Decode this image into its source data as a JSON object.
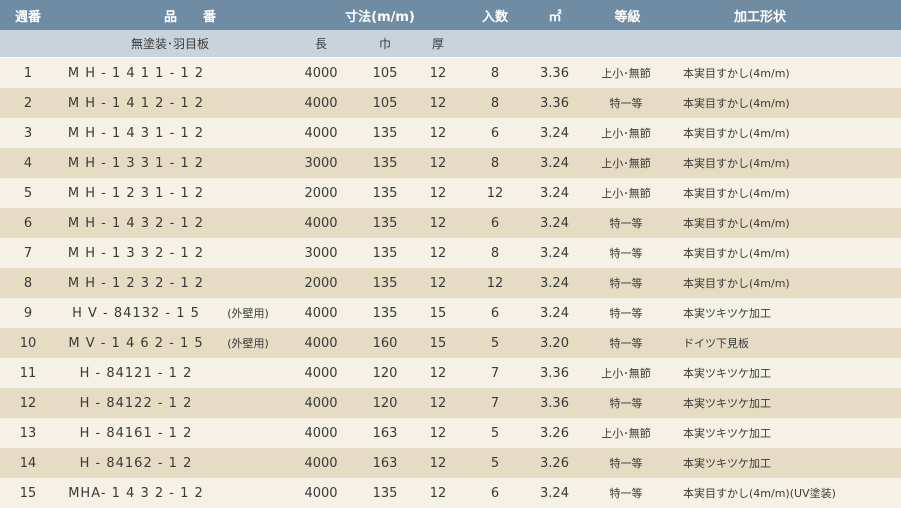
{
  "header": {
    "week": "週番",
    "product": "品　　番",
    "dimensions": "寸法(m/m)",
    "quantity": "入数",
    "area": "㎡",
    "grade": "等級",
    "processing": "加工形状"
  },
  "subheader": {
    "category": "無塗装･羽目板",
    "length": "長",
    "width": "巾",
    "thickness": "厚"
  },
  "rows": [
    {
      "no": "1",
      "part": "M H - 1 4 1 1 - 1 2",
      "note": "",
      "length": "4000",
      "width": "105",
      "thickness": "12",
      "qty": "8",
      "area": "3.36",
      "grade": "上小･無節",
      "shape": "本実目すかし(4m/m)"
    },
    {
      "no": "2",
      "part": "M H - 1 4 1 2 - 1 2",
      "note": "",
      "length": "4000",
      "width": "105",
      "thickness": "12",
      "qty": "8",
      "area": "3.36",
      "grade": "特一等",
      "shape": "本実目すかし(4m/m)"
    },
    {
      "no": "3",
      "part": "M H - 1 4 3 1 - 1 2",
      "note": "",
      "length": "4000",
      "width": "135",
      "thickness": "12",
      "qty": "6",
      "area": "3.24",
      "grade": "上小･無節",
      "shape": "本実目すかし(4m/m)"
    },
    {
      "no": "4",
      "part": "M H - 1 3 3 1 - 1 2",
      "note": "",
      "length": "3000",
      "width": "135",
      "thickness": "12",
      "qty": "8",
      "area": "3.24",
      "grade": "上小･無節",
      "shape": "本実目すかし(4m/m)"
    },
    {
      "no": "5",
      "part": "M H - 1 2 3 1 - 1 2",
      "note": "",
      "length": "2000",
      "width": "135",
      "thickness": "12",
      "qty": "12",
      "area": "3.24",
      "grade": "上小･無節",
      "shape": "本実目すかし(4m/m)"
    },
    {
      "no": "6",
      "part": "M H - 1 4 3 2 - 1 2",
      "note": "",
      "length": "4000",
      "width": "135",
      "thickness": "12",
      "qty": "6",
      "area": "3.24",
      "grade": "特一等",
      "shape": "本実目すかし(4m/m)"
    },
    {
      "no": "7",
      "part": "M H - 1 3 3 2 - 1 2",
      "note": "",
      "length": "3000",
      "width": "135",
      "thickness": "12",
      "qty": "8",
      "area": "3.24",
      "grade": "特一等",
      "shape": "本実目すかし(4m/m)"
    },
    {
      "no": "8",
      "part": "M H - 1 2 3 2 - 1 2",
      "note": "",
      "length": "2000",
      "width": "135",
      "thickness": "12",
      "qty": "12",
      "area": "3.24",
      "grade": "特一等",
      "shape": "本実目すかし(4m/m)"
    },
    {
      "no": "9",
      "part": "H V - 84132 - 1 5",
      "note": "(外壁用)",
      "length": "4000",
      "width": "135",
      "thickness": "15",
      "qty": "6",
      "area": "3.24",
      "grade": "特一等",
      "shape": "本実ツキツケ加工"
    },
    {
      "no": "10",
      "part": "M V - 1 4 6 2 - 1 5",
      "note": "(外壁用)",
      "length": "4000",
      "width": "160",
      "thickness": "15",
      "qty": "5",
      "area": "3.20",
      "grade": "特一等",
      "shape": "ドイツ下見板"
    },
    {
      "no": "11",
      "part": "H - 84121 - 1 2",
      "note": "",
      "length": "4000",
      "width": "120",
      "thickness": "12",
      "qty": "7",
      "area": "3.36",
      "grade": "上小･無節",
      "shape": "本実ツキツケ加工"
    },
    {
      "no": "12",
      "part": "H - 84122 - 1 2",
      "note": "",
      "length": "4000",
      "width": "120",
      "thickness": "12",
      "qty": "7",
      "area": "3.36",
      "grade": "特一等",
      "shape": "本実ツキツケ加工"
    },
    {
      "no": "13",
      "part": "H - 84161 - 1 2",
      "note": "",
      "length": "4000",
      "width": "163",
      "thickness": "12",
      "qty": "5",
      "area": "3.26",
      "grade": "上小･無節",
      "shape": "本実ツキツケ加工"
    },
    {
      "no": "14",
      "part": "H - 84162 - 1 2",
      "note": "",
      "length": "4000",
      "width": "163",
      "thickness": "12",
      "qty": "5",
      "area": "3.26",
      "grade": "特一等",
      "shape": "本実ツキツケ加工"
    },
    {
      "no": "15",
      "part": "MHA- 1 4 3 2 - 1 2",
      "note": "",
      "length": "4000",
      "width": "135",
      "thickness": "12",
      "qty": "6",
      "area": "3.24",
      "grade": "特一等",
      "shape": "本実目すかし(4m/m)(UV塗装)"
    }
  ]
}
